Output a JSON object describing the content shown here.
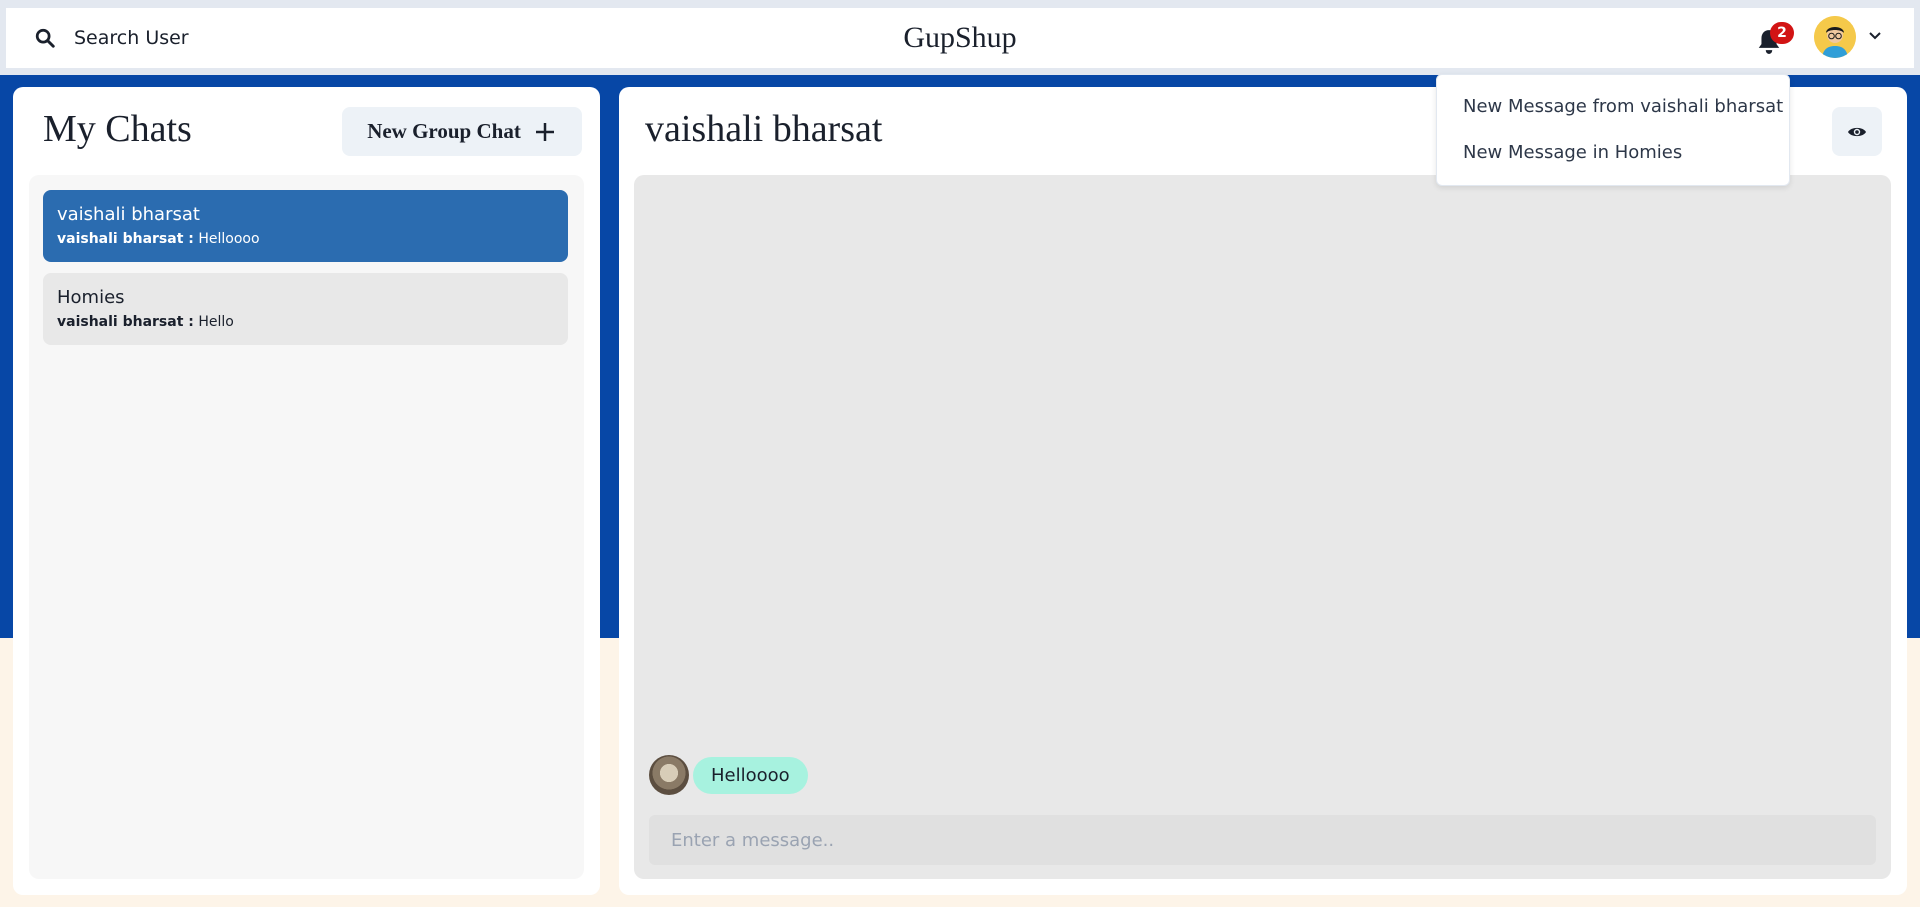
{
  "navbar": {
    "search_label": "Search User",
    "app_title": "GupShup",
    "notification_count": "2",
    "icons": {
      "search": "search-icon",
      "bell": "bell-icon",
      "avatar": "user-avatar",
      "chevron": "chevron-down-icon"
    }
  },
  "notifications": {
    "items": [
      {
        "label": "New Message from vaishali bharsat"
      },
      {
        "label": "New Message in Homies"
      }
    ]
  },
  "sidebar": {
    "title": "My Chats",
    "new_group_label": "New Group Chat",
    "chats": [
      {
        "name": "vaishali bharsat",
        "sender": "vaishali bharsat :",
        "preview": " Helloooo",
        "active": true
      },
      {
        "name": "Homies",
        "sender": "vaishali bharsat :",
        "preview": " Hello",
        "active": false
      }
    ]
  },
  "chat": {
    "title": "vaishali bharsat",
    "messages": [
      {
        "text": "Helloooo"
      }
    ],
    "input_placeholder": "Enter a message.."
  },
  "colors": {
    "brand_blue": "#0747a6",
    "active_chat": "#2b6cb0",
    "bubble": "#a7f2df",
    "badge": "#d21414"
  }
}
